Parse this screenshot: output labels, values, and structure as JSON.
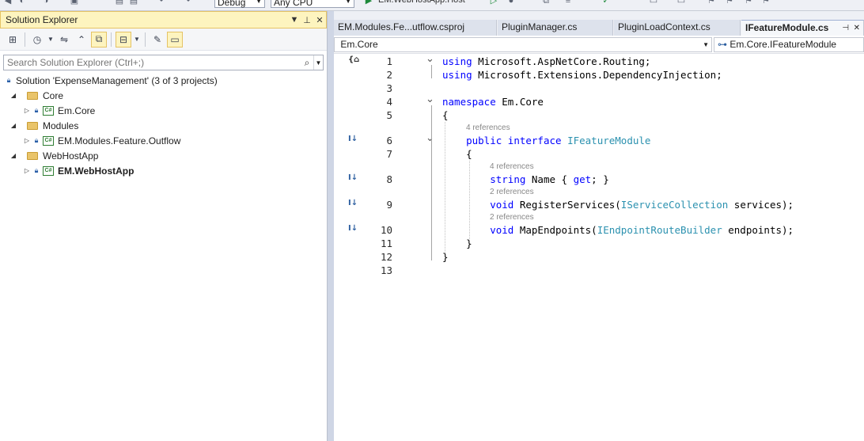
{
  "toolbar": {
    "config": "Debug",
    "platform": "Any CPU",
    "run_target": "EM.WebHostApp.Host"
  },
  "solution_explorer": {
    "title": "Solution Explorer",
    "search_placeholder": "Search Solution Explorer (Ctrl+;)",
    "solution_label": "Solution 'ExpenseManagement' (3 of 3 projects)",
    "tree": [
      {
        "type": "folder",
        "label": "Core",
        "expanded": true
      },
      {
        "type": "project",
        "label": "Em.Core",
        "bold": false
      },
      {
        "type": "folder",
        "label": "Modules",
        "expanded": true
      },
      {
        "type": "project",
        "label": "EM.Modules.Feature.Outflow",
        "bold": false
      },
      {
        "type": "folder",
        "label": "WebHostApp",
        "expanded": true
      },
      {
        "type": "project",
        "label": "EM.WebHostApp",
        "bold": true
      }
    ]
  },
  "editor": {
    "tabs": [
      {
        "label": "EM.Modules.Fe...utflow.csproj",
        "active": false
      },
      {
        "label": "PluginManager.cs",
        "active": false
      },
      {
        "label": "PluginLoadContext.cs",
        "active": false
      },
      {
        "label": "IFeatureModule.cs",
        "active": true
      }
    ],
    "nav_project": "Em.Core",
    "nav_type": "Em.Core.IFeatureModule",
    "lines": [
      {
        "n": "1",
        "tokens": [
          [
            "kw",
            "using"
          ],
          [
            "pl",
            " Microsoft.AspNetCore.Routing;"
          ]
        ]
      },
      {
        "n": "2",
        "tokens": [
          [
            "kw",
            "using"
          ],
          [
            "pl",
            " Microsoft.Extensions.DependencyInjection;"
          ]
        ]
      },
      {
        "n": "3",
        "tokens": []
      },
      {
        "n": "4",
        "tokens": [
          [
            "kw",
            "namespace"
          ],
          [
            "pl",
            " Em.Core"
          ]
        ]
      },
      {
        "n": "5",
        "tokens": [
          [
            "pl",
            "{"
          ]
        ]
      },
      {
        "n": "6",
        "ref": "4 references",
        "tokens": [
          [
            "pl",
            "    "
          ],
          [
            "kw",
            "public"
          ],
          [
            "pl",
            " "
          ],
          [
            "kw",
            "interface"
          ],
          [
            "pl",
            " "
          ],
          [
            "ty",
            "IFeatureModule"
          ]
        ]
      },
      {
        "n": "7",
        "tokens": [
          [
            "pl",
            "    {"
          ]
        ]
      },
      {
        "n": "8",
        "ref": "4 references",
        "tokens": [
          [
            "pl",
            "        "
          ],
          [
            "kw",
            "string"
          ],
          [
            "pl",
            " Name { "
          ],
          [
            "kw",
            "get"
          ],
          [
            "pl",
            "; }"
          ]
        ]
      },
      {
        "n": "9",
        "ref": "2 references",
        "tokens": [
          [
            "pl",
            "        "
          ],
          [
            "kw",
            "void"
          ],
          [
            "pl",
            " RegisterServices("
          ],
          [
            "ty",
            "IServiceCollection"
          ],
          [
            "pl",
            " services);"
          ]
        ]
      },
      {
        "n": "10",
        "ref": "2 references",
        "tokens": [
          [
            "pl",
            "        "
          ],
          [
            "kw",
            "void"
          ],
          [
            "pl",
            " MapEndpoints("
          ],
          [
            "ty",
            "IEndpointRouteBuilder"
          ],
          [
            "pl",
            " endpoints);"
          ]
        ]
      },
      {
        "n": "11",
        "tokens": [
          [
            "pl",
            "    }"
          ]
        ]
      },
      {
        "n": "12",
        "tokens": [
          [
            "pl",
            "}"
          ]
        ]
      },
      {
        "n": "13",
        "tokens": []
      }
    ]
  },
  "colors": {
    "keyword": "#0000ff",
    "type": "#2b91af",
    "accent": "#fdf4bf"
  }
}
